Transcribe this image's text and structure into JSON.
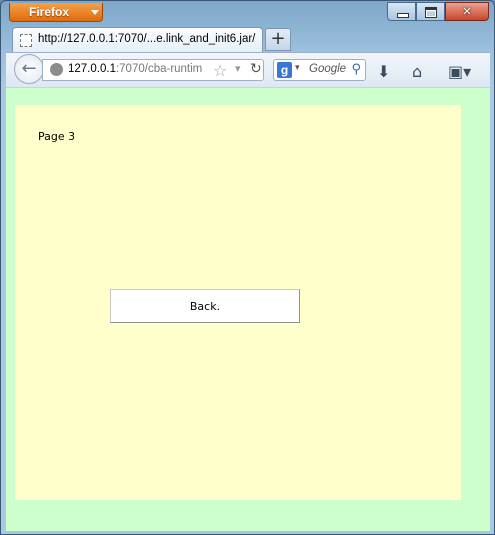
{
  "browser": {
    "app_button_label": "Firefox",
    "tab_title": "http://127.0.0.1:7070/...e.link_and_init6.jar/",
    "new_tab_label": "+",
    "url_host": "127.0.0.1",
    "url_rest": ":7070/cba-runtim",
    "search_placeholder": "Google",
    "search_engine_logo": "g"
  },
  "page": {
    "label": "Page 3",
    "back_button_label": "Back.",
    "colors": {
      "outer_background": "#ccffcc",
      "panel_background": "#ffffcc"
    }
  }
}
